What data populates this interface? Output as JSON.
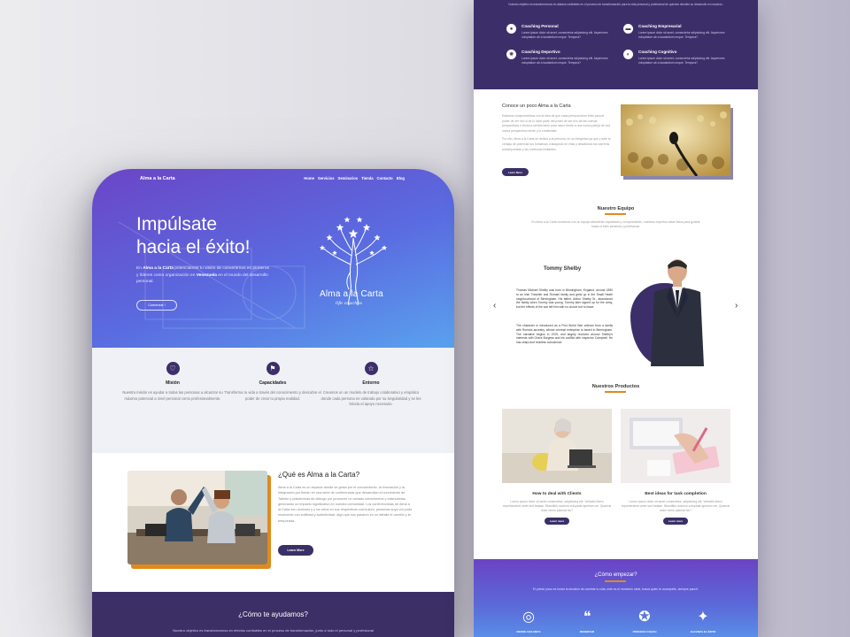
{
  "left": {
    "nav": {
      "logo": "Alma a la Carta",
      "items": [
        "Home",
        "Servicios",
        "Seminarios",
        "Tienda",
        "Contacto",
        "Blog"
      ]
    },
    "hero": {
      "title_line1": "Impúlsate",
      "title_line2": "hacia el éxito!",
      "para_pre": "En",
      "para_brand": "Alma a la Carta",
      "para_mid": "potenciamos tu visión de convertirnos en pioneros y líderes como organización en",
      "para_country": "Venezuela",
      "para_post": "en el mundo del desarrollo personal.",
      "cta": "Comenzar !",
      "brand_name": "Alma a la Carta",
      "brand_sub": "life coaches"
    },
    "features": [
      {
        "icon": "heart-icon",
        "glyph": "♡",
        "title": "Misión",
        "desc": "Nuestra misión es ayudar a todas las personas a alcanzar su máximo potencial a nivel personal como profesionalmente."
      },
      {
        "icon": "flag-icon",
        "glyph": "⚑",
        "title": "Capacidades",
        "desc": "Transforma tu vida a través del conocimiento y descubre el poder de crear tu propia realidad."
      },
      {
        "icon": "star-icon",
        "glyph": "☆",
        "title": "Entorno",
        "desc": "Creamos un un modelo de trabajo colaborativo y empático donde cada persona es valorada por su singularidad y se les brinda el apoyo necesario."
      }
    ],
    "about": {
      "title": "¿Qué es Alma a la Carta?",
      "text": "Alma a la Carta es un espacio donde se gesta por el conocimiento, la innovación y la integración por fluirán en una serie de conferencias que desarrollan el crecimiento de Talento y plataformas de diálogo por promover un variado crecimientos y estimularlas generando un impacto significativo en nuestra comunidad. Los conferencistas de Alma a la Carta son doctores y y los retos en sus respectivos currículum, personas suya vía pudo resolverse con sutilidad y autenticidad, algo que sus pasaron en un detalle el cambio y la temporada.",
      "button": "Learn More"
    },
    "help": {
      "title": "¿Cómo te ayudamos?",
      "text": "Nuestro objetivo es transformarnos en efectos confiables en el proceso de transformación, junto a todo el personal y profesional"
    }
  },
  "right": {
    "services_intro": "Nuestro objetivo es transformarnos en aliados confiables en el proceso de transformación para la vida personal y profesional de quienes deciden su desarrollo en nosotros.",
    "services": [
      {
        "icon": "person-icon",
        "glyph": "●",
        "title": "Coaching Personal",
        "desc": "Lorem ipsum dolor sit amet, consectetur adipisicing elit. Asperiores voluptatum ab a laudantium neque. Tempora?"
      },
      {
        "icon": "briefcase-icon",
        "glyph": "▬",
        "title": "Coaching Empresarial",
        "desc": "Lorem ipsum dolor sit amet, consectetur adipisicing elit. Asperiores voluptatum ab a laudantium neque. Tempora?"
      },
      {
        "icon": "sport-icon",
        "glyph": "✺",
        "title": "Coaching Deportivo",
        "desc": "Lorem ipsum dolor sit amet, consectetur adipisicing elit. Asperiores voluptatum ab a laudantium neque. Tempora?"
      },
      {
        "icon": "brain-icon",
        "glyph": "◐",
        "title": "Coaching Cognitivo",
        "desc": "Lorem ipsum dolor sit amet, consectetur adipisicing elit. Asperiores voluptatum ab a laudantium neque. Tempora?"
      }
    ],
    "know": {
      "title": "Conoce un poco Alma a la Carta",
      "p1": "Estamos comprometidos con la idea de que cada persona tiene éxito para el poder de ser rico si se lo hace parte del poder de ser rico de las nuevas perspectivas e inicia la semilla tanto para hacer frente a una nueva pareja de una nueva perspectiva mente y la creatividad.",
      "p2": "Por ello, Alma a la Carta se dedica a la persona, en su integridad ya que y ante la ventaja de potenciar tus fortalezas, trabajando en ellas y desafiando las barreras autoimpuestas y las creencias limitantes.",
      "button": "Learn More"
    },
    "team": {
      "title": "Nuestro Equipo",
      "intro": "En Alma a la Carta contamos con un equipo altamente capacitado y comprometido, nuestros expertos están listos para guiarte hacia el éxito personal y profesional.",
      "prev": "‹",
      "next": "›",
      "name": "Tommy Shelby",
      "bio1": "Thomas Michael Shelby was born in Birmingham, England, around 1890 to an Irish Traveller and Romani family and grew up in the Small Heath neighbourhood of Birmingham. His father, Arthur Shelby Sr., abandoned the family when Tommy was young. Tommy later signed up for the army, but the effects of the war left him with no choice but to leave.",
      "bio2": "The character is introduced as a First World War veteran from a family with Romani ancestry, whose criminal enterprise is based in Birmingham. The narrative begins in 1919, and largely revolves around Shelby's interests with Grace Burgess and his conflict with Inspector Campbell. He has sharp and reckless conscience."
    },
    "products": {
      "title": "Nuestros Productos",
      "items": [
        {
          "title": "How to deal with Clients",
          "desc": "Lorem ipsum dolor sit amet consectetur, adipisicing elit. Veritatis libero reprehenderit amet sed beatae. Blanditiis nostrum voluptate aperiam vel. Quaerat dolor nemo placeat hic?",
          "button": "Learn more"
        },
        {
          "title": "Best ideas for task completion",
          "desc": "Lorem ipsum dolor sit amet consectetur, adipisicing elit. Veritatis libero reprehenderit amet sed beatae. Blanditiis nostrum voluptate aperiam vel. Quaerat dolor nemo placeat hic?",
          "button": "Learn more"
        }
      ]
    },
    "start": {
      "title": "¿Cómo empezar?",
      "text": "El primer paso es tomar la decisión de cambiar tu vida, este es el momento ideal, busca quien te acompañe, siempre para ti.",
      "steps": [
        {
          "icon": "target-icon",
          "glyph": "◎",
          "label": "DEFINE UNA META"
        },
        {
          "icon": "chat-icon",
          "glyph": "❝",
          "label": "RESERVAR"
        },
        {
          "icon": "head-icon",
          "glyph": "✪",
          "label": "PROCESO COACH"
        },
        {
          "icon": "success-icon",
          "glyph": "✦",
          "label": "ALCANZA EL ÉXITO"
        }
      ]
    }
  },
  "colors": {
    "primary": "#3c2f69",
    "accent": "#e08a1c",
    "hero_start": "#6b45c6",
    "hero_end": "#5aa2ee"
  }
}
